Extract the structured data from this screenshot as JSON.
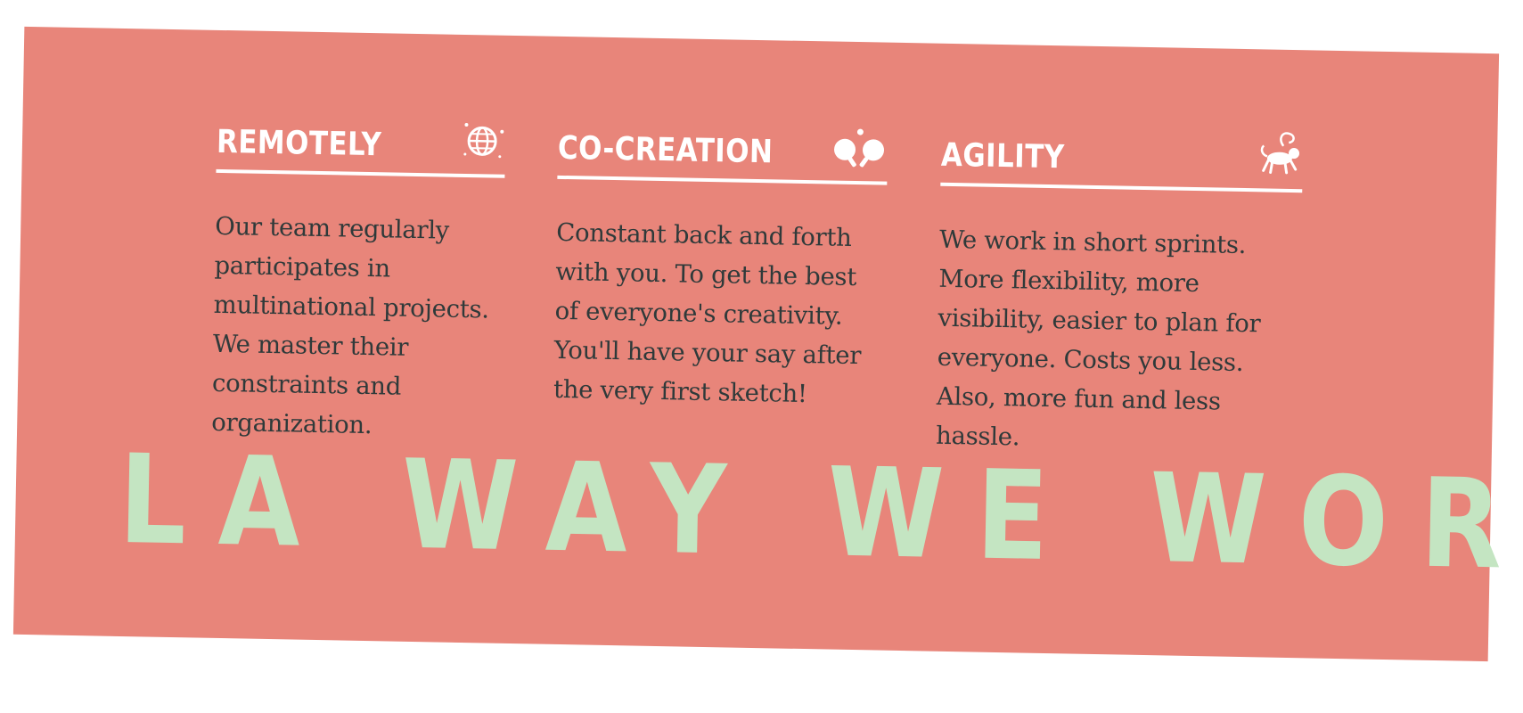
{
  "headline": "LA WAY WE WORK",
  "colors": {
    "panel": "#e8857a",
    "headline": "#c4e5c2",
    "title": "#ffffff",
    "body_text": "#2f3a3a"
  },
  "columns": [
    {
      "title": "REMOTELY",
      "icon": "globe-icon",
      "body": "Our team regularly participates in multinational projects. We master their constraints and organization."
    },
    {
      "title": "CO-CREATION",
      "icon": "ping-pong-icon",
      "body": "Constant back and forth with you. To get the best of everyone's creativity. You'll have your say after the very first sketch!"
    },
    {
      "title": "AGILITY",
      "icon": "monkey-icon",
      "body": "We work in short sprints. More flexibility, more visibility, easier to plan for everyone. Costs you less. Also, more fun and less hassle."
    }
  ]
}
